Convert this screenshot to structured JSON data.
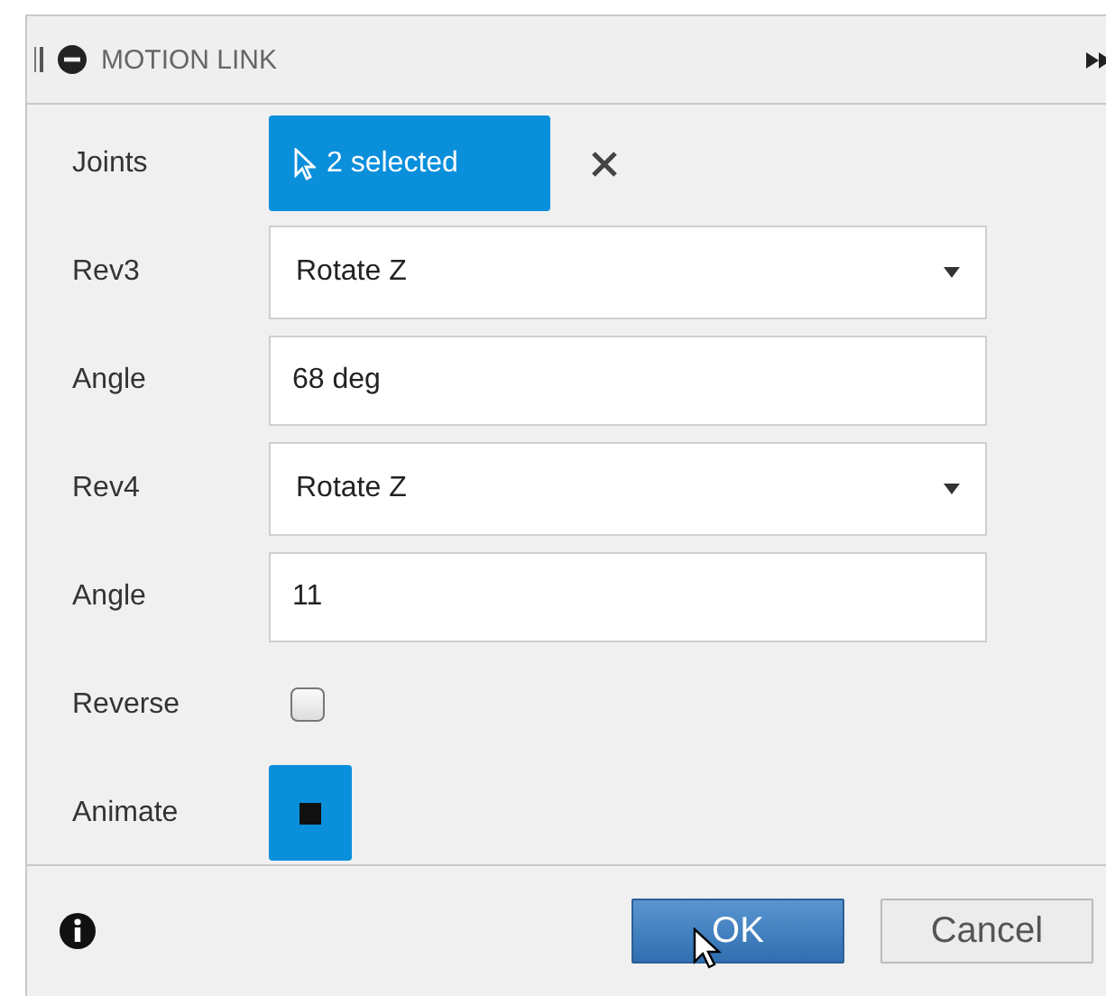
{
  "panel": {
    "title": "MOTION LINK"
  },
  "rows": [
    {
      "kind": "selection",
      "label": "Joints",
      "value": "2 selected",
      "selected": true
    },
    {
      "kind": "select",
      "label": "Rev3",
      "value": "Rotate Z"
    },
    {
      "kind": "text",
      "label": "Angle",
      "value": "68 deg"
    },
    {
      "kind": "select",
      "label": "Rev4",
      "value": "Rotate Z"
    },
    {
      "kind": "text",
      "label": "Angle",
      "value": "11"
    },
    {
      "kind": "checkbox",
      "label": "Reverse",
      "checked": false
    },
    {
      "kind": "toggle",
      "label": "Animate",
      "on": true
    }
  ],
  "buttons": [
    {
      "label": "OK",
      "primary": true
    },
    {
      "label": "Cancel",
      "primary": false
    }
  ]
}
